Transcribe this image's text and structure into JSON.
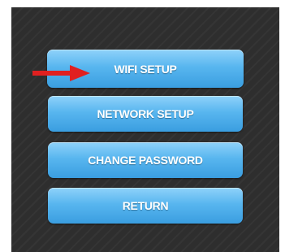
{
  "menu": {
    "items": [
      {
        "label": "WIFI SETUP"
      },
      {
        "label": "NETWORK SETUP"
      },
      {
        "label": "CHANGE PASSWORD"
      },
      {
        "label": "RETURN"
      }
    ]
  },
  "annotation": {
    "arrow_icon": "right-arrow-icon",
    "arrow_color": "#e02020"
  },
  "colors": {
    "background": "#2e2e2e",
    "button": "#4aaee8",
    "button_text": "#ffffff"
  }
}
